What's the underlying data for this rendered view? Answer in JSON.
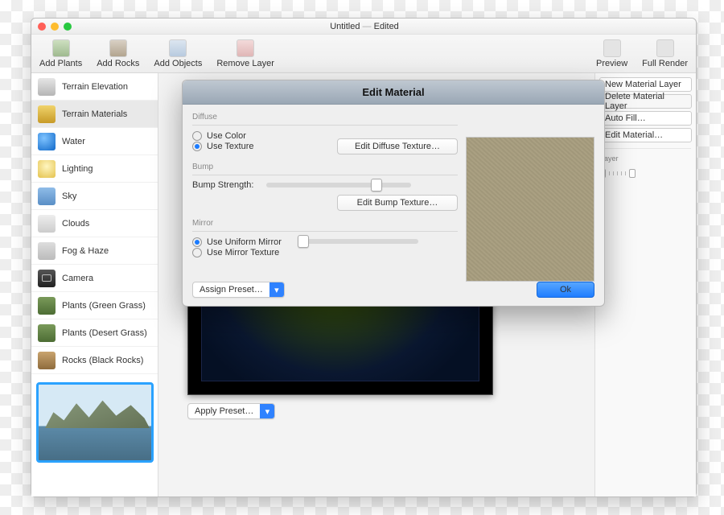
{
  "window": {
    "title": "Untitled",
    "edited": "Edited"
  },
  "toolbar": {
    "add_plants": "Add Plants",
    "add_rocks": "Add Rocks",
    "add_objects": "Add Objects",
    "remove_layer": "Remove Layer",
    "preview": "Preview",
    "full_render": "Full Render"
  },
  "sidebar": {
    "items": [
      {
        "label": "Terrain Elevation"
      },
      {
        "label": "Terrain Materials"
      },
      {
        "label": "Water"
      },
      {
        "label": "Lighting"
      },
      {
        "label": "Sky"
      },
      {
        "label": "Clouds"
      },
      {
        "label": "Fog & Haze"
      },
      {
        "label": "Camera"
      },
      {
        "label": "Plants (Green Grass)"
      },
      {
        "label": "Plants (Desert Grass)"
      },
      {
        "label": "Rocks (Black Rocks)"
      }
    ],
    "selected_index": 1
  },
  "main": {
    "apply_preset": "Apply Preset…"
  },
  "right": {
    "new_layer": "New Material Layer",
    "delete_layer": "Delete Material Layer",
    "auto_fill": "Auto Fill…",
    "edit_material": "Edit Material…",
    "layer_label": "Layer"
  },
  "dialog": {
    "title": "Edit Material",
    "diffuse": {
      "legend": "Diffuse",
      "use_color": "Use Color",
      "use_texture": "Use Texture",
      "selected": "use_texture",
      "edit_btn": "Edit Diffuse Texture…"
    },
    "bump": {
      "legend": "Bump",
      "strength_label": "Bump Strength:",
      "strength_value": 0.75,
      "edit_btn": "Edit Bump Texture…"
    },
    "mirror": {
      "legend": "Mirror",
      "use_uniform": "Use Uniform Mirror",
      "use_texture": "Use Mirror Texture",
      "selected": "use_uniform",
      "uniform_value": 0.0
    },
    "assign_preset": "Assign Preset…",
    "ok": "Ok"
  }
}
